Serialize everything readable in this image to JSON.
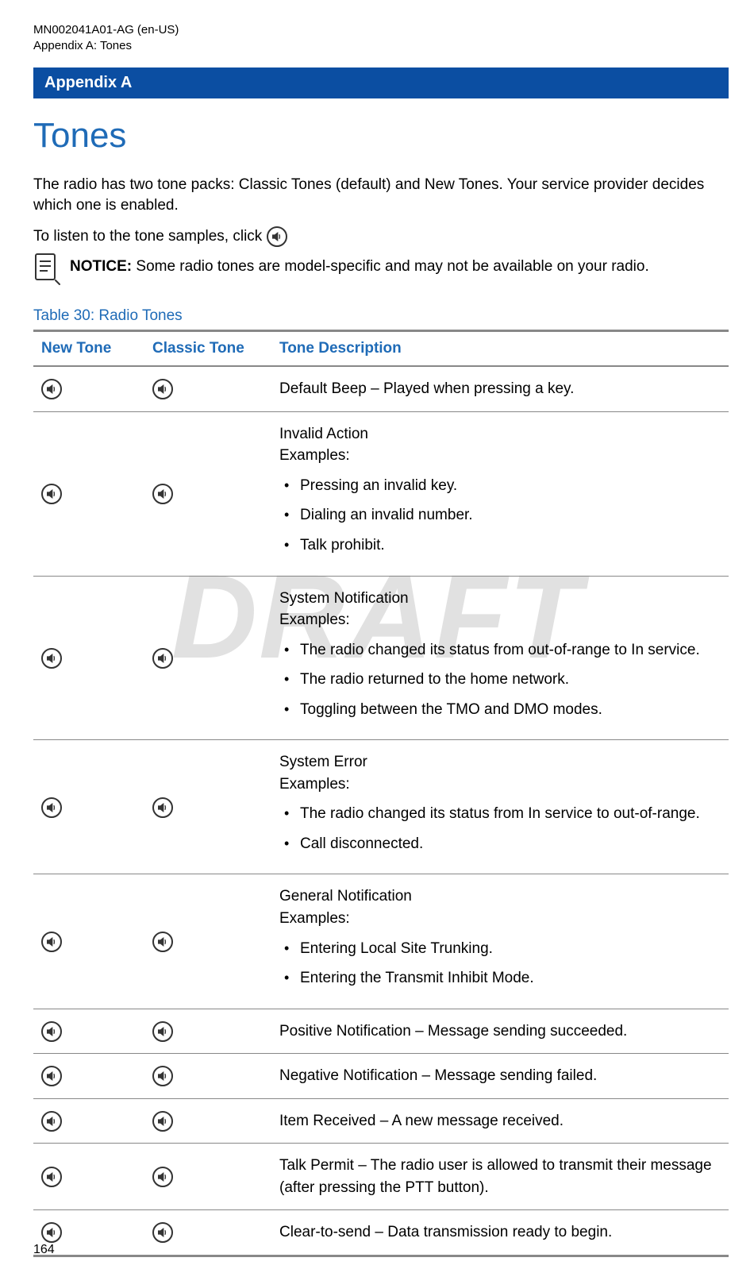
{
  "header": {
    "doc_id": "MN002041A01-AG (en-US)",
    "section": "Appendix A:  Tones"
  },
  "appendix_bar": "Appendix A",
  "title": "Tones",
  "intro": "The radio has two tone packs: Classic Tones (default) and New Tones. Your service provider decides which one is enabled.",
  "listen_prefix": "To listen to the tone samples, click",
  "notice_label": "NOTICE:",
  "notice_text": "Some radio tones are model-specific and may not be available on your radio.",
  "caption": "Table 30: Radio Tones",
  "columns": {
    "c1": "New Tone",
    "c2": "Classic Tone",
    "c3": "Tone Description"
  },
  "rows": [
    {
      "type": "simple",
      "text": "Default Beep – Played when pressing a key."
    },
    {
      "type": "list",
      "title": "Invalid Action",
      "examples_label": "Examples:",
      "items": [
        "Pressing an invalid key.",
        "Dialing an invalid number.",
        "Talk prohibit."
      ]
    },
    {
      "type": "list",
      "title": "System Notification",
      "examples_label": "Examples:",
      "items": [
        "The radio changed its status from out-of-range to In service.",
        "The radio returned to the home network.",
        "Toggling between the TMO and DMO modes."
      ]
    },
    {
      "type": "list",
      "title": "System Error",
      "examples_label": "Examples:",
      "items": [
        "The radio changed its status from In service to out-of-range.",
        "Call disconnected."
      ]
    },
    {
      "type": "list",
      "title": "General Notification",
      "examples_label": "Examples:",
      "items": [
        "Entering Local Site Trunking.",
        "Entering the Transmit Inhibit Mode."
      ]
    },
    {
      "type": "simple",
      "text": "Positive Notification – Message sending succeeded."
    },
    {
      "type": "simple",
      "text": "Negative Notification – Message sending failed."
    },
    {
      "type": "simple",
      "text": "Item Received – A new message received."
    },
    {
      "type": "simple",
      "text": "Talk Permit – The radio user is allowed to transmit their message (after pressing the PTT button)."
    },
    {
      "type": "simple",
      "text": "Clear-to-send – Data transmission ready to begin."
    }
  ],
  "page_number": "164",
  "watermark": "DRAFT"
}
